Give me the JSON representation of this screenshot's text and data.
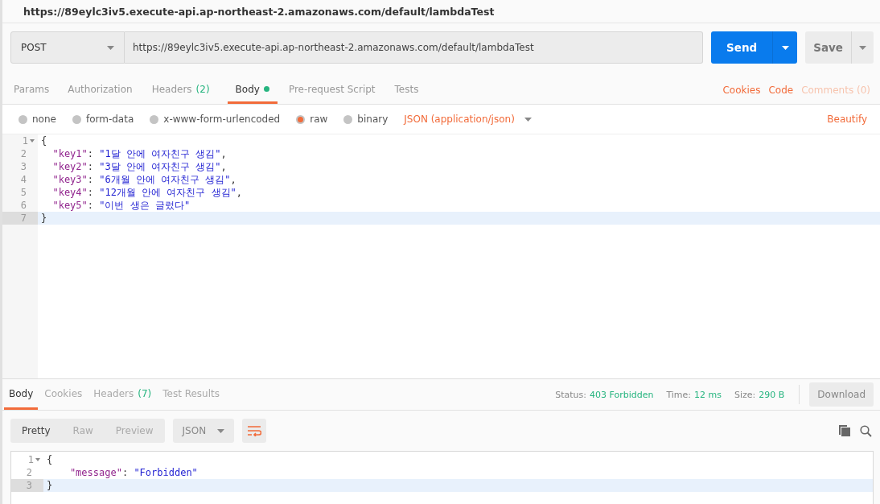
{
  "window": {
    "title": "https://89eylc3iv5.execute-api.ap-northeast-2.amazonaws.com/default/lambdaTest"
  },
  "request": {
    "method": "POST",
    "url": "https://89eylc3iv5.execute-api.ap-northeast-2.amazonaws.com/default/lambdaTest",
    "send": "Send",
    "save": "Save"
  },
  "tabs": [
    {
      "label": "Params",
      "selected": false
    },
    {
      "label": "Authorization",
      "selected": false
    },
    {
      "label": "Headers",
      "count": "(2)",
      "selected": false
    },
    {
      "label": "Body",
      "dot": true,
      "selected": true
    },
    {
      "label": "Pre-request Script",
      "selected": false
    },
    {
      "label": "Tests",
      "selected": false
    }
  ],
  "tab_links": [
    {
      "label": "Cookies",
      "disabled": false
    },
    {
      "label": "Code",
      "disabled": false
    },
    {
      "label": "Comments (0)",
      "disabled": true
    }
  ],
  "body_types": [
    {
      "label": "none",
      "selected": false
    },
    {
      "label": "form-data",
      "selected": false
    },
    {
      "label": "x-www-form-urlencoded",
      "selected": false
    },
    {
      "label": "raw",
      "selected": true
    },
    {
      "label": "binary",
      "selected": false
    }
  ],
  "content_type": "JSON (application/json)",
  "beautify": "Beautify",
  "editor": {
    "lines": [
      {
        "number": "1",
        "foldable": true,
        "current": false,
        "tokens": [
          {
            "kind": "punct",
            "text": "{"
          }
        ]
      },
      {
        "number": "2",
        "foldable": false,
        "current": false,
        "tokens": [
          {
            "kind": "key",
            "text": "  \"key1\""
          },
          {
            "kind": "punct",
            "text": ": "
          },
          {
            "kind": "string",
            "text": "\"1달 안에 여자친구 생김\""
          },
          {
            "kind": "punct",
            "text": ","
          }
        ]
      },
      {
        "number": "3",
        "foldable": false,
        "current": false,
        "tokens": [
          {
            "kind": "key",
            "text": "  \"key2\""
          },
          {
            "kind": "punct",
            "text": ": "
          },
          {
            "kind": "string",
            "text": "\"3달 안에 여자친구 생김\""
          },
          {
            "kind": "punct",
            "text": ","
          }
        ]
      },
      {
        "number": "4",
        "foldable": false,
        "current": false,
        "tokens": [
          {
            "kind": "key",
            "text": "  \"key3\""
          },
          {
            "kind": "punct",
            "text": ": "
          },
          {
            "kind": "string",
            "text": "\"6개월 안에 여자친구 생김\""
          },
          {
            "kind": "punct",
            "text": ","
          }
        ]
      },
      {
        "number": "5",
        "foldable": false,
        "current": false,
        "tokens": [
          {
            "kind": "key",
            "text": "  \"key4\""
          },
          {
            "kind": "punct",
            "text": ": "
          },
          {
            "kind": "string",
            "text": "\"12개월 안에 여자친구 생김\""
          },
          {
            "kind": "punct",
            "text": ","
          }
        ]
      },
      {
        "number": "6",
        "foldable": false,
        "current": false,
        "tokens": [
          {
            "kind": "key",
            "text": "  \"key5\""
          },
          {
            "kind": "punct",
            "text": ": "
          },
          {
            "kind": "string",
            "text": "\"이번 생은 글렀다\""
          }
        ]
      },
      {
        "number": "7",
        "foldable": false,
        "current": true,
        "tokens": [
          {
            "kind": "punct",
            "text": "}"
          }
        ]
      }
    ]
  },
  "response": {
    "tabs": [
      {
        "label": "Body",
        "selected": true
      },
      {
        "label": "Cookies",
        "selected": false
      },
      {
        "label": "Headers",
        "count": "(7)",
        "selected": false
      },
      {
        "label": "Test Results",
        "selected": false
      }
    ],
    "stats": [
      {
        "label": "Status:",
        "value": "403 Forbidden"
      },
      {
        "label": "Time:",
        "value": "12 ms"
      },
      {
        "label": "Size:",
        "value": "290 B"
      }
    ],
    "download": "Download",
    "views": [
      {
        "label": "Pretty",
        "selected": true
      },
      {
        "label": "Raw",
        "selected": false
      },
      {
        "label": "Preview",
        "selected": false
      }
    ],
    "format": "JSON",
    "lines": [
      {
        "number": "1",
        "foldable": true,
        "current": false,
        "tokens": [
          {
            "kind": "punct",
            "text": "{"
          }
        ]
      },
      {
        "number": "2",
        "foldable": false,
        "current": false,
        "tokens": [
          {
            "kind": "key",
            "text": "    \"message\""
          },
          {
            "kind": "punct",
            "text": ": "
          },
          {
            "kind": "string",
            "text": "\"Forbidden\""
          }
        ]
      },
      {
        "number": "3",
        "foldable": false,
        "current": true,
        "tokens": [
          {
            "kind": "punct",
            "text": "}"
          }
        ]
      }
    ]
  }
}
